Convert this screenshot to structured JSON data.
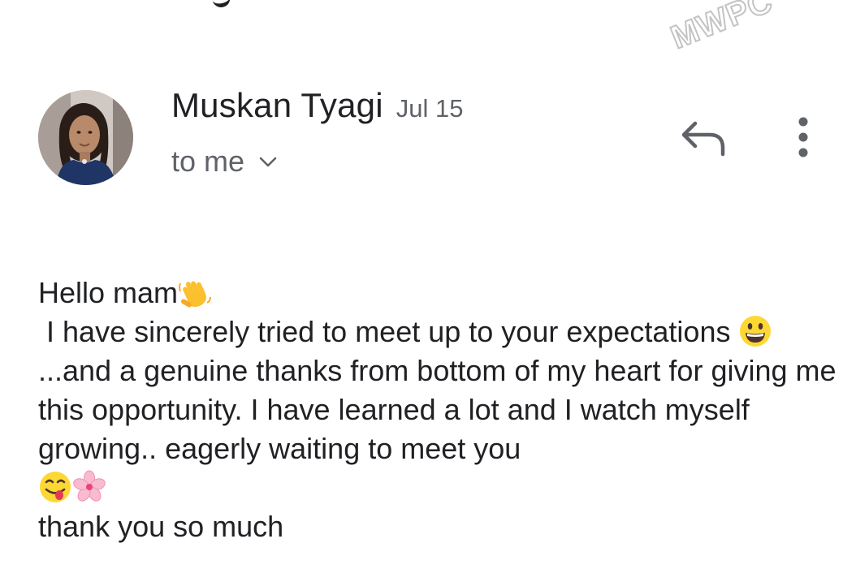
{
  "watermark": "MWPC",
  "message": {
    "sender_name": "Muskan Tyagi",
    "date": "Jul 15",
    "recipient_label": "to me",
    "avatar": "profile-photo",
    "actions": {
      "reply_icon": "reply-icon",
      "more_icon": "more-vertical-icon",
      "expand_icon": "chevron-down-icon"
    },
    "body": {
      "line1_text": "Hello mam",
      "line1_emoji": "waving-hand",
      "line2_text": " I have sincerely tried to meet up to your expectations ",
      "line2_emoji": "grinning-face",
      "line2_cont": "...and a genuine thanks from bottom of my heart for giving me this opportunity. I have learned a lot and I watch myself growing.. eagerly waiting to meet you ",
      "line3_emoji_1": "face-savoring-food",
      "line3_emoji_2": "cherry-blossom",
      "line4_text": "thank you so much"
    }
  },
  "colors": {
    "text_primary": "#202124",
    "text_secondary": "#5f6368",
    "icon": "#5f6368"
  }
}
